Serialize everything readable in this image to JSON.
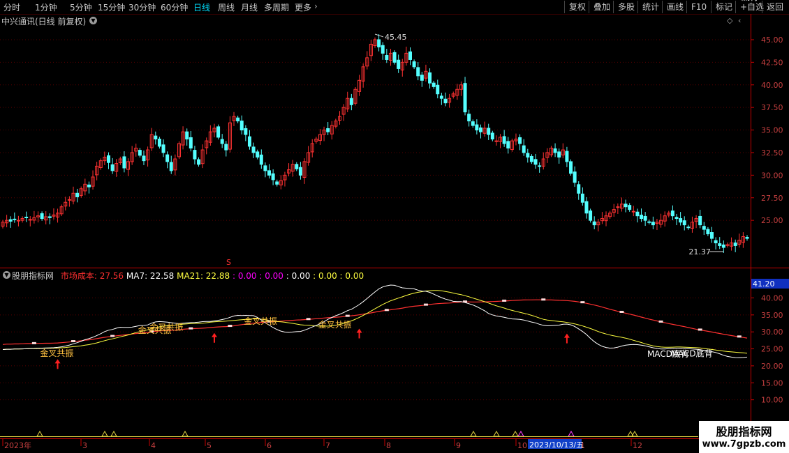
{
  "toolbar": {
    "timeframes": [
      "分时",
      "1分钟",
      "5分钟",
      "15分钟",
      "30分钟",
      "60分钟",
      "日线",
      "周线",
      "月线",
      "多周期",
      "更多"
    ],
    "active": "日线",
    "right_buttons": [
      "复权",
      "叠加",
      "多股",
      "统计",
      "画线",
      "F10",
      "标记",
      "+自选",
      "返回"
    ]
  },
  "stock": {
    "title": "中兴通讯(日线 前复权)"
  },
  "price_axis": {
    "labels": [
      "45.00",
      "42.50",
      "40.00",
      "37.50",
      "35.00",
      "32.50",
      "30.00",
      "27.50",
      "25.00"
    ]
  },
  "chart_data": [
    {
      "type": "candlestick",
      "title": "中兴通讯(日线 前复权)",
      "ylim": [
        21.0,
        46.0
      ],
      "annotations": {
        "high": "45.45",
        "low": "21.37"
      },
      "close_series": [
        24.8,
        25.0,
        24.9,
        25.1,
        25.0,
        25.2,
        25.3,
        25.1,
        25.3,
        25.5,
        25.2,
        25.4,
        25.3,
        25.6,
        25.8,
        26.5,
        27.0,
        27.3,
        28.0,
        27.6,
        28.5,
        29.0,
        28.7,
        29.8,
        31.0,
        31.6,
        32.0,
        31.4,
        30.5,
        31.3,
        31.8,
        30.8,
        31.5,
        32.5,
        33.0,
        32.2,
        31.6,
        32.8,
        34.5,
        34.0,
        33.2,
        32.5,
        31.5,
        30.5,
        31.8,
        33.5,
        34.8,
        34.0,
        33.0,
        31.8,
        31.2,
        32.8,
        33.8,
        34.8,
        35.2,
        34.2,
        33.5,
        32.8,
        35.8,
        36.5,
        36.0,
        35.0,
        34.5,
        33.2,
        32.5,
        32.0,
        31.2,
        30.5,
        30.0,
        29.5,
        29.0,
        29.4,
        30.0,
        30.6,
        31.2,
        30.7,
        30.0,
        31.5,
        32.5,
        33.5,
        34.0,
        34.5,
        35.0,
        34.8,
        35.5,
        36.0,
        36.5,
        37.5,
        38.5,
        37.8,
        39.5,
        40.5,
        42.0,
        43.0,
        44.5,
        45.0,
        44.2,
        43.5,
        42.8,
        43.5,
        42.5,
        41.8,
        42.5,
        43.5,
        42.8,
        42.0,
        41.0,
        40.5,
        41.5,
        40.2,
        39.8,
        39.0,
        38.5,
        38.0,
        38.5,
        39.0,
        39.5,
        40.0,
        37.0,
        36.0,
        35.5,
        35.0,
        34.8,
        35.2,
        34.5,
        34.0,
        33.8,
        34.2,
        33.5,
        33.0,
        33.8,
        34.0,
        33.5,
        32.5,
        32.0,
        31.5,
        31.2,
        31.0,
        31.8,
        32.5,
        33.0,
        32.5,
        32.0,
        32.8,
        31.5,
        30.2,
        29.2,
        28.0,
        27.0,
        25.8,
        25.0,
        24.5,
        24.8,
        25.2,
        25.5,
        25.8,
        26.2,
        26.5,
        26.8,
        26.5,
        26.2,
        26.0,
        25.5,
        25.2,
        25.0,
        24.8,
        24.5,
        24.8,
        25.0,
        25.5,
        25.8,
        25.5,
        25.2,
        24.8,
        24.5,
        24.2,
        24.8,
        25.2,
        24.5,
        24.0,
        23.5,
        23.0,
        22.5,
        22.2,
        22.0,
        22.3,
        22.5,
        22.2,
        22.8,
        23.2,
        23.0
      ]
    },
    {
      "type": "line",
      "title": "股朋指标网",
      "ylim": [
        5.0,
        44.0
      ],
      "legend": [
        {
          "name": "市场成本",
          "value": "27.56",
          "color": "#ff3030"
        },
        {
          "name": "MA7",
          "value": "22.58",
          "color": "#ffffff"
        },
        {
          "name": "MA21",
          "value": "22.88",
          "color": "#ffff40"
        },
        {
          "name": "",
          "value": "0.00",
          "color": "#ff00ff"
        },
        {
          "name": "",
          "value": "0.00",
          "color": "#ff00ff"
        },
        {
          "name": "",
          "value": "0.00",
          "color": "#ffffff"
        },
        {
          "name": "",
          "value": "0.00",
          "color": "#ffff40"
        },
        {
          "name": "",
          "value": "0.00",
          "color": "#ffff40"
        }
      ],
      "axis_labels": [
        "40.00",
        "35.00",
        "30.00",
        "25.00",
        "20.00",
        "15.00",
        "10.00"
      ],
      "current_value": "41.20",
      "signals": [
        {
          "text": "金叉共振",
          "color": "#ffc040"
        },
        {
          "text": "金叉共振",
          "color": "#ffc040"
        },
        {
          "text": "金叉共振",
          "color": "#ffc040"
        },
        {
          "text": "金叉共振",
          "color": "#ffc040"
        },
        {
          "text": "金叉共振",
          "color": "#ffc040"
        },
        {
          "text": "MACD底背",
          "color": "#ffffff"
        },
        {
          "text": "MACD底背",
          "color": "#ffffff"
        },
        {
          "text": "MACD底背",
          "color": "#ffffff"
        }
      ]
    }
  ],
  "time_axis": {
    "labels": [
      "2023年",
      "3",
      "4",
      "5",
      "6",
      "7",
      "8",
      "9",
      "10",
      "11",
      "12"
    ],
    "cursor_date": "2023/10/13/五"
  },
  "colors": {
    "up": "#ff3232",
    "down": "#54ffff",
    "cost": "#ff3030",
    "ma7": "#ffffff",
    "ma21": "#ffff40",
    "axis": "#c80000"
  },
  "watermark": {
    "line1": "股朋指标网",
    "line2": "www.7gpzb.com"
  }
}
